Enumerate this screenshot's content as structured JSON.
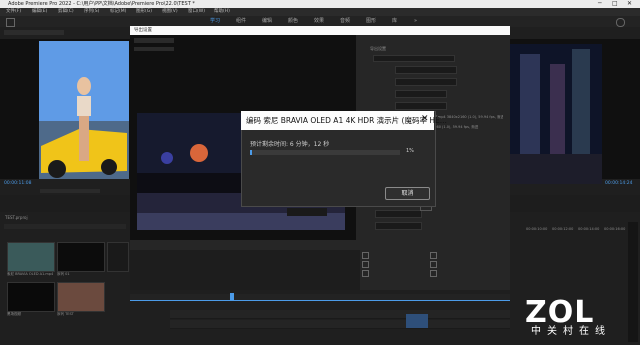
{
  "app": {
    "title": "Adobe Premiere Pro 2022 - C:\\用户\\PP\\文档\\Adobe\\Premiere Pro\\22.0\\TEST *",
    "window_controls": [
      "─",
      "□",
      "✕"
    ]
  },
  "menu": [
    "文件(F)",
    "编辑(E)",
    "剪辑(C)",
    "序列(S)",
    "标记(M)",
    "图形(G)",
    "视图(V)",
    "窗口(W)",
    "帮助(H)"
  ],
  "workspaces": [
    {
      "label": "学习",
      "active": true
    },
    {
      "label": "组件",
      "active": false
    },
    {
      "label": "编辑",
      "active": false
    },
    {
      "label": "颜色",
      "active": false
    },
    {
      "label": "效果",
      "active": false
    },
    {
      "label": "音频",
      "active": false
    },
    {
      "label": "图形",
      "active": false
    },
    {
      "label": "库",
      "active": false
    },
    {
      "label": "»",
      "active": false
    }
  ],
  "source_monitor": {
    "timecode": "00:00:11:08"
  },
  "program_monitor": {
    "timecode": "00:00:14:24"
  },
  "export_settings": {
    "title": "导出设置",
    "section_title": "导出设置",
    "summary": "输出：C:\\用户\\PP\\...\\TEST.mp4 3840x2160 (1.0), 59.94 fps, 渐进",
    "source_summary": "源：序列, TEST 3840x2160 (1.0), 59.94 fps, 渐进"
  },
  "encoding_dialog": {
    "title": "编码 索尼 BRAVIA OLED A1 4K HDR 演示片 (魔码率 HE...",
    "remaining": "预计剩余时间: 6 分钟，12 秒",
    "percent": "1%",
    "progress": 0.01,
    "cancel_label": "取消",
    "close_icon": "✕"
  },
  "project": {
    "name": "TEST.prproj",
    "items": [
      {
        "label": "索尼 BRAVIA OLED A1.mp4",
        "duration": "2:59"
      },
      {
        "label": "序列 01",
        "duration": "0:00"
      },
      {
        "label": "调整图层",
        "duration": ""
      },
      {
        "label": "黑场视频",
        "duration": ""
      },
      {
        "label": "序列 TEST",
        "duration": "14:24"
      }
    ]
  },
  "timeline": {
    "ruler": [
      "00:00:10:00",
      "00:00:12:00",
      "00:00:14:00",
      "00:00:16:00"
    ]
  },
  "watermark": {
    "brand": "ZOL",
    "tagline": "中关村在线"
  },
  "colors": {
    "accent": "#4c9be8",
    "dialog_header": "#fdfdfd",
    "panel": "#1f1f1f"
  }
}
